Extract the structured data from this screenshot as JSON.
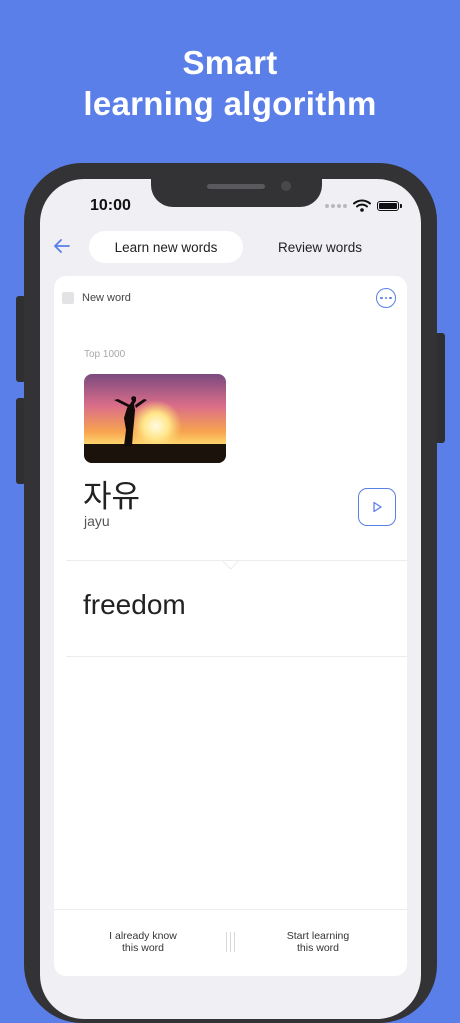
{
  "headline": {
    "line1": "Smart",
    "line2": "learning algorithm"
  },
  "status_bar": {
    "time": "10:00"
  },
  "nav": {
    "tabs": [
      "Learn new words",
      "Review words"
    ],
    "active_tab": "Learn new words"
  },
  "card": {
    "new_word_label": "New word",
    "frequency_label": "Top 1000",
    "word": "자유",
    "romanization": "jayu",
    "translation": "freedom",
    "image_icon": "sunset-silhouette-photo"
  },
  "actions": {
    "already_know": {
      "line1": "I already know",
      "line2": "this word"
    },
    "start_learning": {
      "line1": "Start learning",
      "line2": "this word"
    }
  },
  "colors": {
    "accent": "#5b7fe8",
    "background": "#5b7fe8",
    "screen": "#efeff4"
  }
}
